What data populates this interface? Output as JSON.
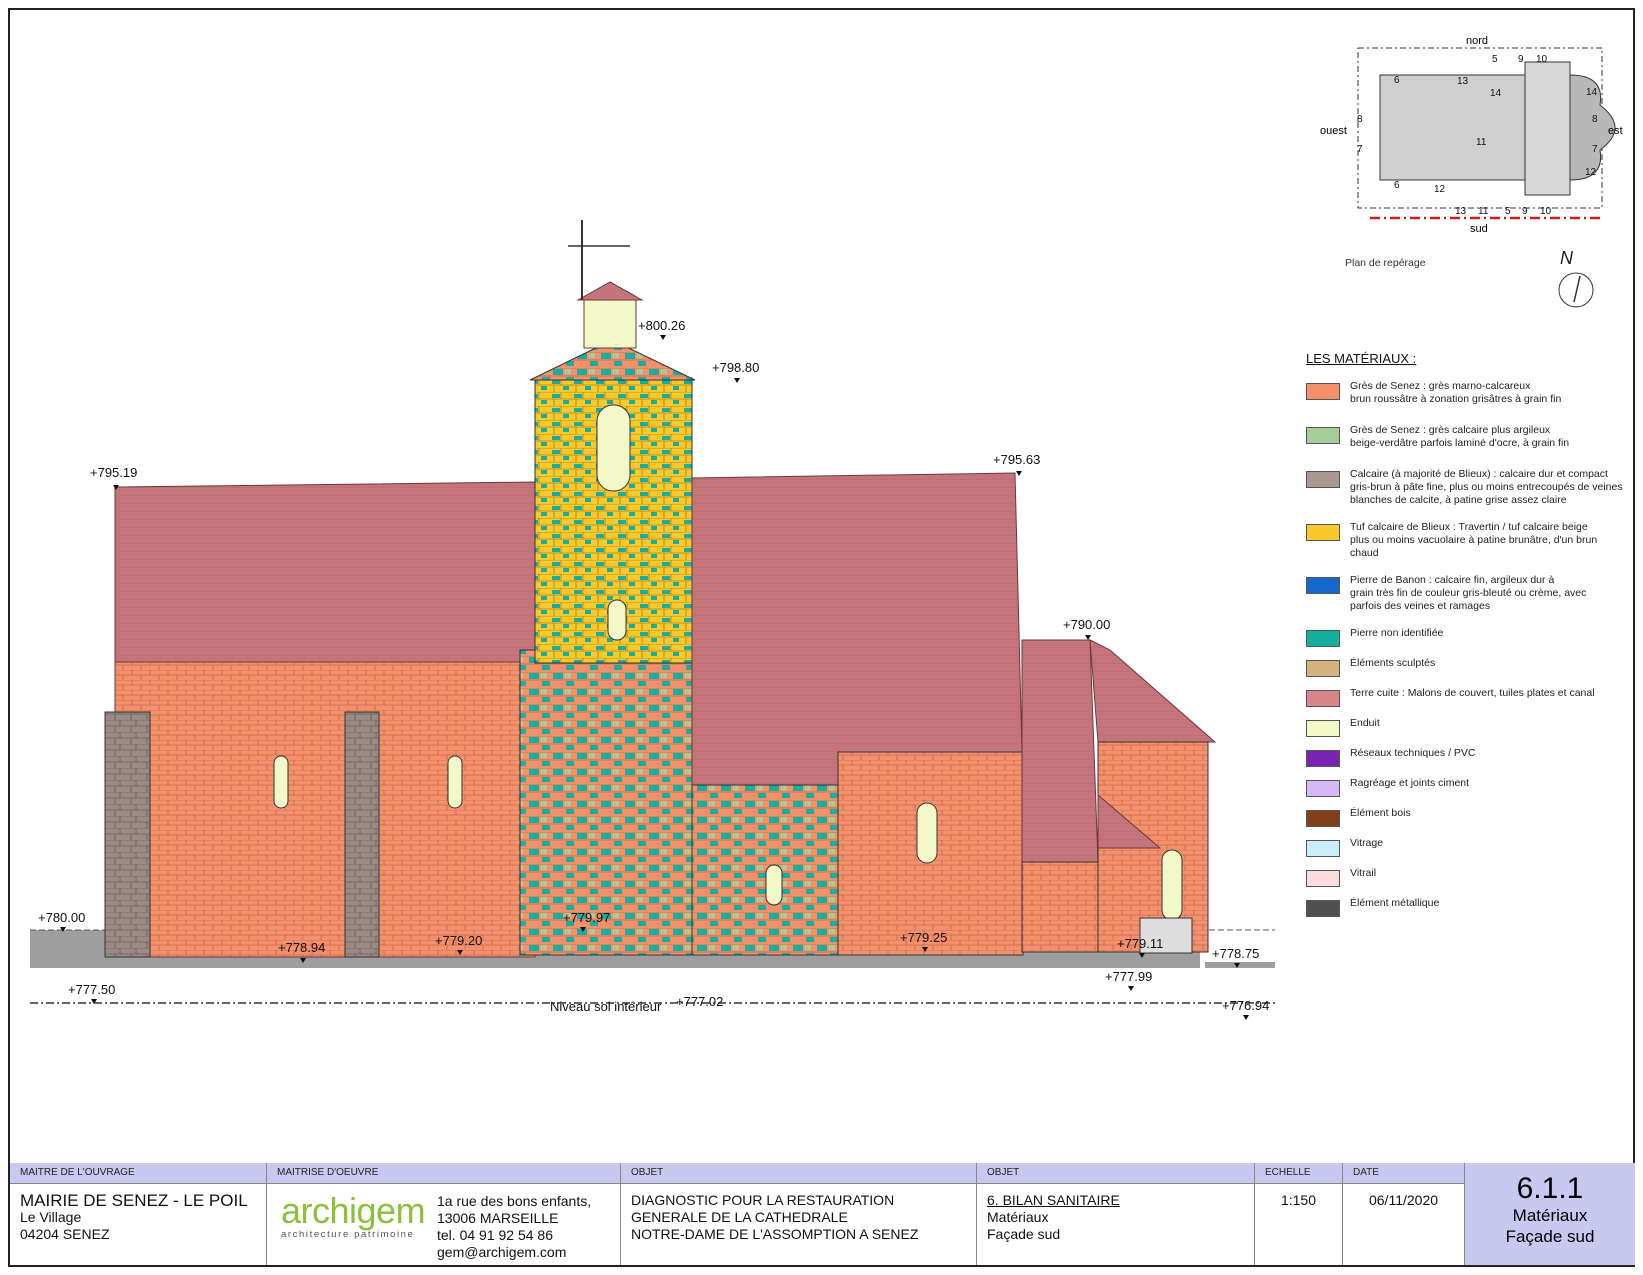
{
  "elevation": {
    "levels": {
      "l795_19": "+795.19",
      "l800_26": "+800.26",
      "l798_80": "+798.80",
      "l795_63": "+795.63",
      "l790_00": "+790.00",
      "l780_00": "+780.00",
      "l778_94": "+778.94",
      "l779_20": "+779.20",
      "l779_97": "+779.97",
      "l779_25": "+779.25",
      "l779_11": "+779.11",
      "l778_75": "+778.75",
      "l777_50": "+777.50",
      "l777_99": "+777.99",
      "l777_02": "+777.02",
      "l776_94": "+776.94"
    },
    "floor_label": "Niveau sol intérieur"
  },
  "location_plan": {
    "nord": "nord",
    "sud": "sud",
    "est": "est",
    "ouest": "ouest",
    "label": "Plan de repérage",
    "north_mark": "N",
    "markers": {
      "m5": "5",
      "m9": "9",
      "m10": "10",
      "m6a": "6",
      "m13a": "13",
      "m14a": "14",
      "m14b": "14",
      "m8a": "8",
      "m7a": "7",
      "m8b": "8",
      "m7b": "7",
      "m11a": "11",
      "m12a": "12",
      "m6b": "6",
      "m12b": "12",
      "m13b": "13",
      "m11b": "11",
      "m5b": "5",
      "m9b": "9",
      "m10b": "10"
    }
  },
  "legend": {
    "title": "LES MATÉRIAUX :",
    "items": [
      {
        "color": "#f4906c",
        "lines": [
          "Grès de Senez : grès marno-calcareux",
          "brun roussâtre à zonation grisâtres à grain fin"
        ]
      },
      {
        "color": "#a6cc98",
        "lines": [
          "Grès de Senez : grès calcaire plus argileux",
          "beige-verdâtre parfois laminé d'ocre, à grain fin"
        ]
      },
      {
        "color": "#a89890",
        "lines": [
          "Calcaire (à majorité de Blieux) : calcaire dur et compact",
          "gris-brun à pâte fine, plus ou moins entrecoupés de veines",
          "blanches de calcite, à patine grise assez claire"
        ]
      },
      {
        "color": "#f8c82c",
        "lines": [
          "Tuf calcaire de Blieux : Travertin / tuf calcaire beige",
          "plus ou moins vacuolaire à patine brunâtre, d'un brun",
          "chaud"
        ]
      },
      {
        "color": "#1668cc",
        "lines": [
          "Pierre de Banon : calcaire fin, argileux dur à",
          "grain très fin de couleur gris-bleuté ou crème, avec",
          "parfois des veines et ramages"
        ]
      },
      {
        "color": "#16ae9e",
        "lines": [
          "Pierre non identifiée"
        ]
      },
      {
        "color": "#d4b47c",
        "lines": [
          "Éléments sculptés"
        ]
      },
      {
        "color": "#d88488",
        "lines": [
          "Terre cuite : Malons de couvert, tuiles plates et canal"
        ]
      },
      {
        "color": "#f2f8c8",
        "lines": [
          "Enduit"
        ]
      },
      {
        "color": "#7a22b4",
        "lines": [
          "Réseaux techniques / PVC"
        ]
      },
      {
        "color": "#d4b8f8",
        "lines": [
          "Ragréage et joints ciment"
        ]
      },
      {
        "color": "#82401a",
        "lines": [
          "Élément bois"
        ]
      },
      {
        "color": "#c8eef8",
        "lines": [
          "Vitrage"
        ]
      },
      {
        "color": "#fcdcdc",
        "lines": [
          "Vitrail"
        ]
      },
      {
        "color": "#505050",
        "lines": [
          "Élément métallique"
        ]
      }
    ]
  },
  "title_block": {
    "owner_head": "MAITRE DE L'OUVRAGE",
    "owner_name": "MAIRIE DE SENEZ - LE POIL",
    "owner_line2": "Le Village",
    "owner_line3": "04204 SENEZ",
    "moe_head": "MAITRISE D'OEUVRE",
    "logo": "archigem",
    "logo_sub": "architecture patrimoine",
    "addr1": "1a rue des bons enfants,",
    "addr2": "13006 MARSEILLE",
    "addr3": "tel. 04 91 92 54 86",
    "addr4": "gem@archigem.com",
    "obj1_head": "OBJET",
    "obj1_l1": "DIAGNOSTIC POUR LA RESTAURATION",
    "obj1_l2": "GENERALE DE LA CATHEDRALE",
    "obj1_l3": "NOTRE-DAME DE L'ASSOMPTION A SENEZ",
    "obj2_head": "OBJET",
    "obj2_l1": "6. BILAN SANITAIRE",
    "obj2_l2": "Matériaux",
    "obj2_l3": "Façade sud",
    "scale_head": "ECHELLE",
    "scale": "1:150",
    "date_head": "DATE",
    "date": "06/11/2020",
    "ref_num": "6.1.1",
    "ref_l1": "Matériaux",
    "ref_l2": "Façade sud"
  }
}
